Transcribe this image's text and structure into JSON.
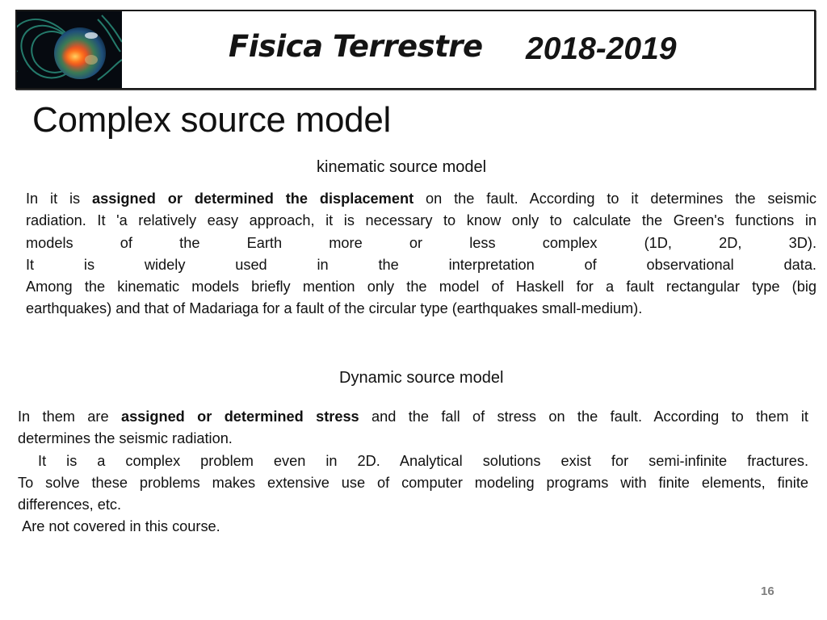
{
  "banner": {
    "image_label": "earth-magnetosphere-image",
    "course_title": "Fisica Terrestre",
    "academic_year": "2018-2019"
  },
  "slide": {
    "title": "Complex source model",
    "page_number": "16"
  },
  "kinematic": {
    "heading": "kinematic source model",
    "lines": [
      {
        "pre": "In it is ",
        "bold": "assigned or determined the displacement",
        "post": " on the fault. According to it determines the seismic"
      },
      {
        "pre": "radiation. It 'a relatively easy approach, it is necessary to know only to calculate the Green's functions in"
      },
      {
        "pre": "models of the Earth more or less complex (1D, 2D, 3D)."
      },
      {
        "pre": "It is widely used in the interpretation of observational data."
      },
      {
        "pre": "Among the kinematic models briefly mention only the model of Haskell for a fault rectangular type (big"
      },
      {
        "pre": "earthquakes) and that of Madariaga for a fault of the circular type (earthquakes small-medium)."
      }
    ]
  },
  "dynamic": {
    "heading": "Dynamic source model",
    "lines": [
      {
        "pre": "In them are ",
        "bold": "assigned or determined stress",
        "post": " and the fall of stress on the fault. According to them it"
      },
      {
        "pre": "determines the seismic radiation."
      },
      {
        "pre": " It is a complex problem even in 2D. Analytical solutions exist for semi-infinite fractures."
      },
      {
        "pre": "To solve these problems makes extensive use of computer modeling programs with finite elements, finite"
      },
      {
        "pre": "differences, etc."
      },
      {
        "pre": " Are not covered in this course."
      }
    ]
  }
}
